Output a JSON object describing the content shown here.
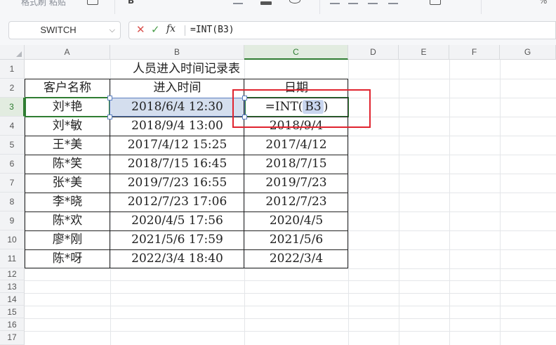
{
  "ribbon": {
    "partial_text": "格式刷 粘贴",
    "percent": "%"
  },
  "formula_bar": {
    "name_box": "SWITCH",
    "cancel_icon": "✕",
    "confirm_icon": "✓",
    "fx_label": "fx",
    "formula": "=INT(B3)"
  },
  "columns": [
    "A",
    "B",
    "C",
    "D",
    "E",
    "F",
    "G"
  ],
  "rows": [
    "1",
    "2",
    "3",
    "4",
    "5",
    "6",
    "7",
    "8",
    "9",
    "10",
    "11",
    "12",
    "13",
    "14",
    "15",
    "16",
    "17"
  ],
  "sheet": {
    "title": "人员进入时间记录表",
    "headers": {
      "customer": "客户名称",
      "entry_time": "进入时间",
      "date": "日期"
    },
    "editing_cell": {
      "prefix": "=INT(",
      "ref": "B3",
      "suffix": ")"
    },
    "records": [
      {
        "name": "刘*艳",
        "time": "2018/6/4 12:30",
        "date": ""
      },
      {
        "name": "刘*敏",
        "time": "2018/9/4 13:00",
        "date": "2018/9/4"
      },
      {
        "name": "王*美",
        "time": "2017/4/12 15:25",
        "date": "2017/4/12"
      },
      {
        "name": "陈*笑",
        "time": "2018/7/15 16:45",
        "date": "2018/7/15"
      },
      {
        "name": "张*美",
        "time": "2019/7/23 16:55",
        "date": "2019/7/23"
      },
      {
        "name": "李*晓",
        "time": "2012/7/23 17:06",
        "date": "2012/7/23"
      },
      {
        "name": "陈*欢",
        "time": "2020/4/5 17:56",
        "date": "2020/4/5"
      },
      {
        "name": "廖*刚",
        "time": "2021/5/6 17:59",
        "date": "2021/5/6"
      },
      {
        "name": "陈*呀",
        "time": "2022/3/4 18:40",
        "date": "2022/3/4"
      }
    ]
  },
  "colors": {
    "selection_green": "#2f7d32",
    "highlight_red": "#e0242f",
    "selected_fill": "#d4deee"
  }
}
